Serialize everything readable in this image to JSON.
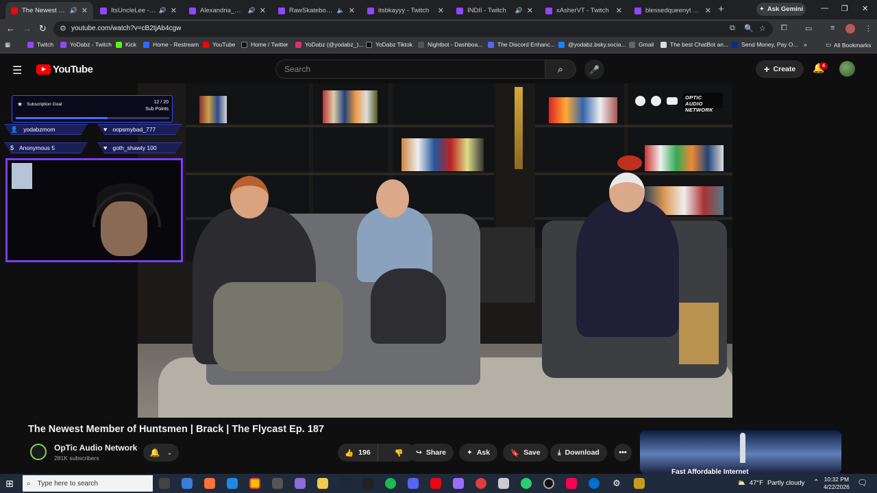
{
  "browser": {
    "tabs": [
      {
        "title": "The Newest Memb",
        "active": true,
        "favicon_color": "#ff0000"
      },
      {
        "title": "ItsUncleLee - Twitch",
        "active": false,
        "favicon_color": "#9146ff"
      },
      {
        "title": "Alexandria_Doom",
        "active": false,
        "favicon_color": "#9146ff"
      },
      {
        "title": "RawSkateboards -",
        "active": false,
        "favicon_color": "#9146ff"
      },
      {
        "title": "itsbkayyy - Twitch",
        "active": false,
        "favicon_color": "#9146ff"
      },
      {
        "title": "INDII - Twitch",
        "active": false,
        "favicon_color": "#9146ff"
      },
      {
        "title": "xAsherVT - Twitch",
        "active": false,
        "favicon_color": "#9146ff"
      },
      {
        "title": "blessedqueenyt - Twitch",
        "active": false,
        "favicon_color": "#9146ff"
      }
    ],
    "ask_gemini": "Ask Gemini",
    "url": "youtube.com/watch?v=cB2tjAb4cgw",
    "bookmarks": [
      {
        "label": "Twitch",
        "color": "#9146ff"
      },
      {
        "label": "YoDabz - Twitch",
        "color": "#9146ff"
      },
      {
        "label": "Kick",
        "color": "#53fc18"
      },
      {
        "label": "Home - Restream",
        "color": "#2b6cff"
      },
      {
        "label": "YouTube",
        "color": "#ff0000"
      },
      {
        "label": "Home / Twitter",
        "color": "#111111"
      },
      {
        "label": "YoDabz (@yodabz_)...",
        "color": "#e1306c"
      },
      {
        "label": "YoDabz Tiktok",
        "color": "#111111"
      },
      {
        "label": "Nightbot - Dashboa...",
        "color": "#555555"
      },
      {
        "label": "The Discord Enhanc...",
        "color": "#5865f2"
      },
      {
        "label": "@yodabz.bsky.socia...",
        "color": "#1185fe"
      },
      {
        "label": "Gmail",
        "color": "#666666"
      },
      {
        "label": "The best ChatBot an...",
        "color": "#dddddd"
      },
      {
        "label": "Send Money, Pay O...",
        "color": "#003087"
      }
    ],
    "all_bookmarks": "All Bookmarks"
  },
  "youtube": {
    "logo_text": "YouTube",
    "search_placeholder": "Search",
    "create_label": "Create",
    "notification_count": "4",
    "video_title": "The Newest Member of Huntsmen | Brack | The Flycast Ep. 187",
    "channel_name": "OpTic Audio Network",
    "subscribers": "281K subscribers",
    "like_count": "196",
    "share_label": "Share",
    "ask_label": "Ask",
    "save_label": "Save",
    "download_label": "Download",
    "ad_title": "Fast Affordable Internet"
  },
  "overlay": {
    "sub_goal_title": "Subscription Goal",
    "sub_goal_count": "12 / 20",
    "sub_goal_unit": "Sub Points",
    "sub_goal_progress": 0.6,
    "alerts": [
      {
        "icon": "person-icon",
        "text": "yodabzmom"
      },
      {
        "icon": "heart-icon",
        "text": "oopsmybad_777"
      },
      {
        "icon": "dollar-icon",
        "text": "Anonymous 5"
      },
      {
        "icon": "heart-icon",
        "text": "goth_shawty 100"
      }
    ],
    "watermark": "OPTIC AUDIO NETWORK"
  },
  "taskbar": {
    "search_placeholder": "Type here to search",
    "temperature": "47°F",
    "weather": "Partly cloudy",
    "time": "10:32 PM",
    "date": "4/22/2026"
  }
}
